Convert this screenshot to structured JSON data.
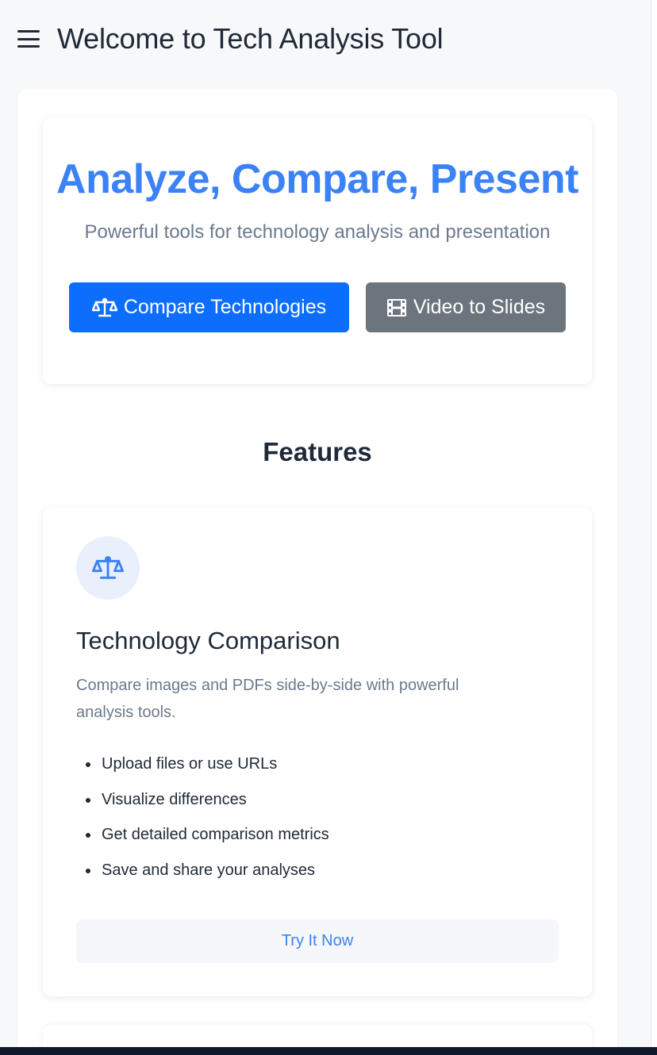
{
  "header": {
    "title": "Welcome to Tech Analysis Tool",
    "menu_icon": "hamburger-icon"
  },
  "hero": {
    "title": "Analyze, Compare, Present",
    "subtitle": "Powerful tools for technology analysis and presentation",
    "primary_button": {
      "label": "Compare Technologies",
      "icon": "balance-scale-icon"
    },
    "secondary_button": {
      "label": "Video to Slides",
      "icon": "film-icon"
    }
  },
  "features": {
    "heading": "Features",
    "cards": [
      {
        "icon": "balance-scale-icon",
        "title": "Technology Comparison",
        "description": "Compare images and PDFs side-by-side with powerful analysis tools.",
        "items": [
          "Upload files or use URLs",
          "Visualize differences",
          "Get detailed comparison metrics",
          "Save and share your analyses"
        ],
        "cta": "Try It Now"
      }
    ]
  },
  "colors": {
    "accent": "#3b82f6",
    "primary_button": "#0d6efd",
    "secondary_button": "#6c757d",
    "background": "#f7f8fa"
  }
}
